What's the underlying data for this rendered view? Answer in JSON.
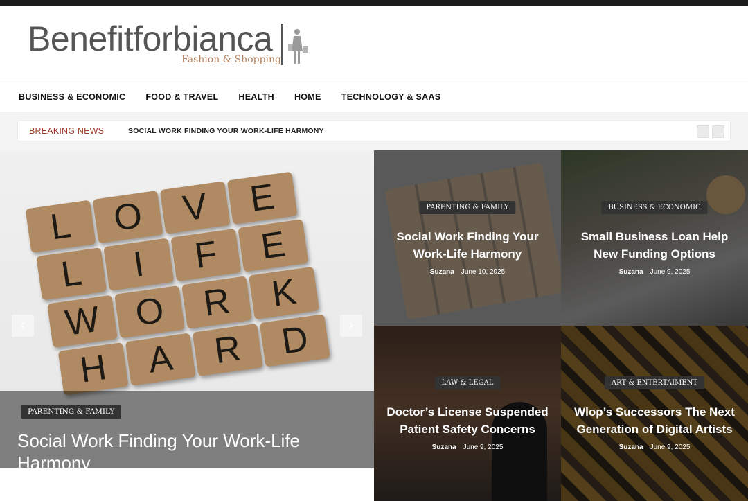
{
  "site": {
    "name": "Benefitforbianca",
    "tagline": "Fashion & Shopping"
  },
  "nav": {
    "items": [
      "BUSINESS & ECONOMIC",
      "FOOD & TRAVEL",
      "HEALTH",
      "HOME",
      "TECHNOLOGY & SAAS"
    ]
  },
  "breaking": {
    "label": "BREAKING NEWS",
    "headline": "SOCIAL WORK FINDING YOUR WORK-LIFE HARMONY"
  },
  "hero": {
    "category": "PARENTING & FAMILY",
    "title": "Social Work Finding Your Work-Life Harmony",
    "prev_icon": "chevron-left-icon",
    "next_icon": "chevron-right-icon",
    "image_tiles": [
      "L",
      "O",
      "V",
      "E",
      "L",
      "I",
      "F",
      "E",
      "W",
      "O",
      "R",
      "K",
      "H",
      "A",
      "R",
      "D"
    ]
  },
  "cards": [
    {
      "category": "PARENTING & FAMILY",
      "title": "Social Work Finding Your Work-Life Harmony",
      "author": "Suzana",
      "date": "June 10, 2025"
    },
    {
      "category": "BUSINESS & ECONOMIC",
      "title": "Small Business Loan Help New Funding Options",
      "author": "Suzana",
      "date": "June 9, 2025"
    },
    {
      "category": "LAW & LEGAL",
      "title": "Doctor’s License Suspended Patient Safety Concerns",
      "author": "Suzana",
      "date": "June 9, 2025"
    },
    {
      "category": "ART & ENTERTAIMENT",
      "title": "Wlop’s Successors The Next Generation of Digital Artists",
      "author": "Suzana",
      "date": "June 9, 2025"
    }
  ],
  "colors": {
    "accent_breaking": "#a0392b",
    "tagline": "#b08060",
    "topbar": "#1c1c1c"
  }
}
